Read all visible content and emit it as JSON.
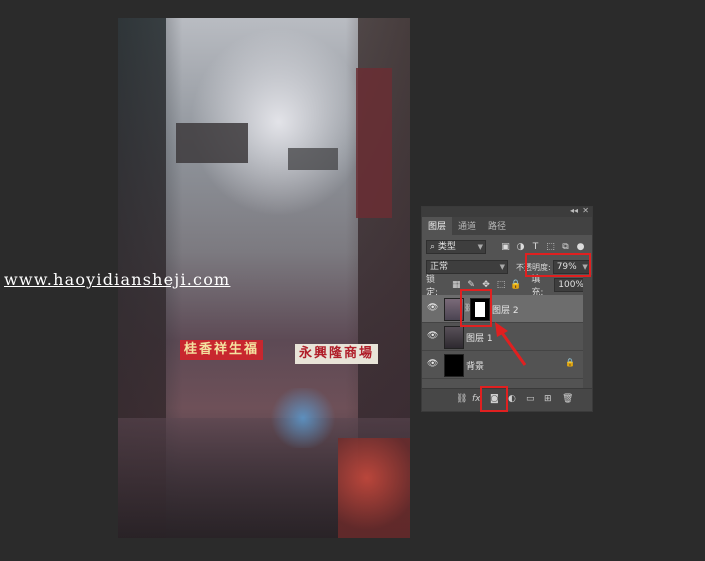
{
  "watermark": "www.haoyidiansheji.com",
  "canvas": {
    "sign_left": "桂香祥生福",
    "sign_right": "永興隆商場"
  },
  "layers_panel": {
    "tabs": [
      "图层",
      "通道",
      "路径"
    ],
    "active_tab": 0,
    "filter_label": "类型",
    "blend_mode": "正常",
    "opacity_label": "不透明度:",
    "opacity_value": "79%",
    "lock_label": "锁定:",
    "fill_label": "填充:",
    "fill_value": "100%",
    "layers": [
      {
        "name": "图层 2",
        "selected": true,
        "has_mask": true
      },
      {
        "name": "图层 1",
        "selected": false,
        "has_mask": false
      },
      {
        "name": "背景",
        "selected": false,
        "has_mask": false,
        "locked": true
      }
    ],
    "colors": {
      "highlight": "#e02020",
      "panel_bg": "#535353",
      "selected_row": "#6d6d6d"
    }
  }
}
